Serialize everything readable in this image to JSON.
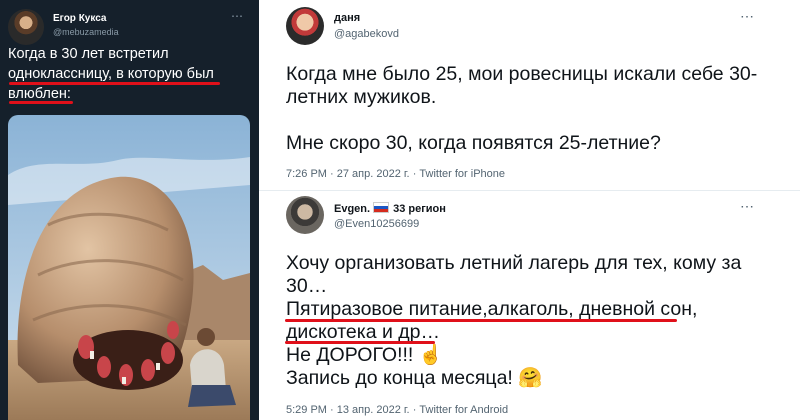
{
  "left_tweet": {
    "author_name": "Егор Кукса",
    "author_handle": "@mebuzamedia",
    "lines": [
      "Когда в 30 лет встретил",
      "одноклассницу, в которую был",
      "влюблен:"
    ]
  },
  "tweet_1": {
    "author_name": "даня",
    "author_handle": "@agabekovd",
    "lines": [
      "Когда мне было 25, мои ровесницы искали себе 30-",
      "летних мужиков."
    ],
    "lines_2": [
      "Мне скоро 30, когда появятся 25-летние?"
    ],
    "time": "7:26 PM",
    "date": "27 апр. 2022 г.",
    "source": "Twitter for iPhone",
    "sep": "·"
  },
  "tweet_2": {
    "author_name": "Evgen.",
    "author_suffix": "33 регион",
    "author_handle": "@Even10256699",
    "lines": [
      "Хочу организовать летний лагерь для тех, кому за",
      "30…",
      "Пятиразовое питание,алкаголь, дневной сон,",
      "дискотека и др…",
      "Не ДОРОГО!!! ☝️",
      "Запись до конца месяца! 🤗"
    ],
    "time": "5:29 PM",
    "date": "13 апр. 2022 г.",
    "source": "Twitter for Android",
    "sep": "·"
  },
  "icons": {
    "more": "⋯",
    "flag": "russian-flag-icon"
  },
  "colors": {
    "dark_bg": "#15202b",
    "highlight_underline": "#e0101a",
    "secondary_text": "#536471"
  }
}
